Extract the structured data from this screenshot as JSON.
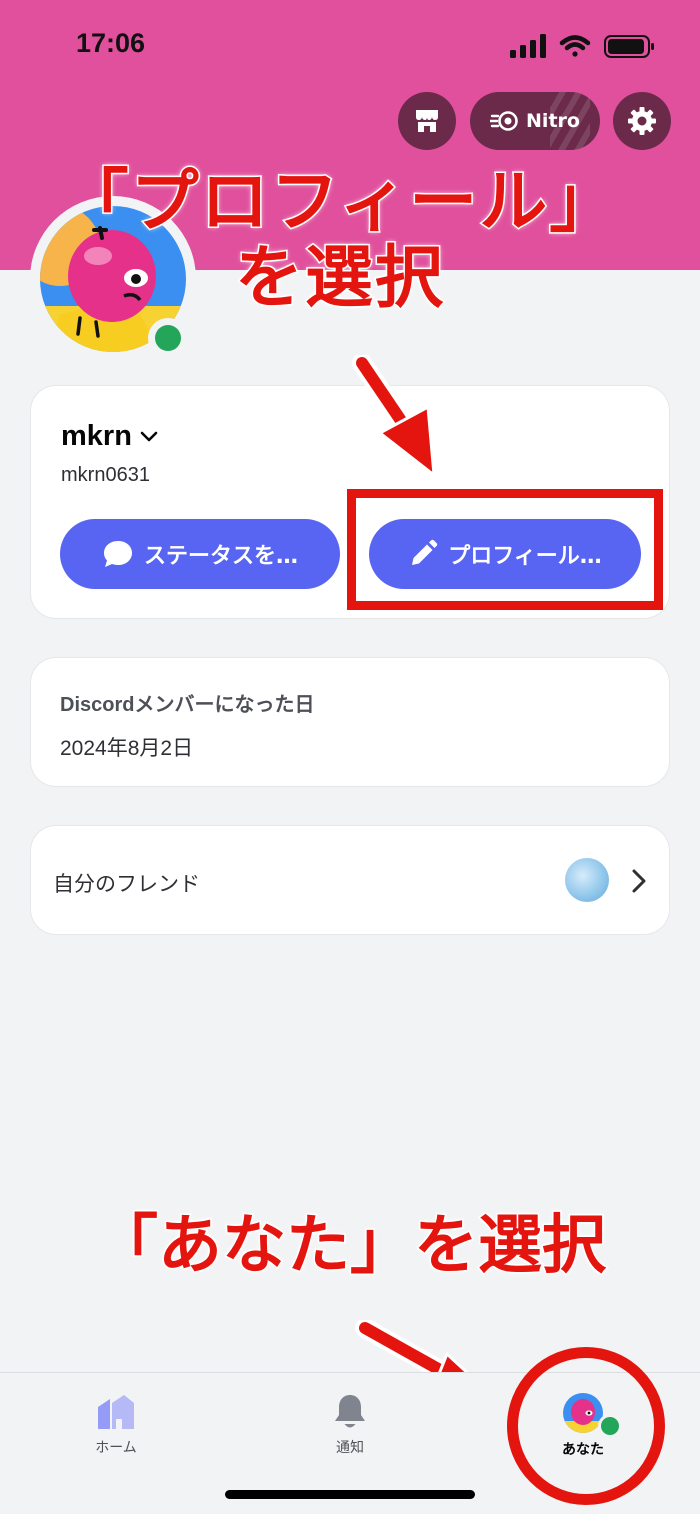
{
  "status_bar": {
    "time": "17:06"
  },
  "header": {
    "nitro_label": "Nitro",
    "shop_icon": "shop-icon",
    "settings_icon": "gear-icon",
    "banner_color": "#e0509c"
  },
  "profile": {
    "display_name": "mkrn",
    "username": "mkrn0631",
    "status": "online",
    "status_button_label": "ステータスを…",
    "edit_profile_button_label": "プロフィール…"
  },
  "member_since": {
    "label": "Discordメンバーになった日",
    "date": "2024年8月2日"
  },
  "friends": {
    "label": "自分のフレンド"
  },
  "annotations": {
    "top_line1": "「プロフィール」",
    "top_line2": "を選択",
    "bottom": "「あなた」を選択",
    "color": "#e4140e"
  },
  "tabbar": {
    "items": [
      {
        "label": "ホーム",
        "icon": "home-icon"
      },
      {
        "label": "通知",
        "icon": "bell-icon"
      },
      {
        "label": "あなた",
        "icon": "avatar-icon"
      }
    ]
  },
  "colors": {
    "blurple": "#5865f2",
    "online": "#23a55a"
  }
}
